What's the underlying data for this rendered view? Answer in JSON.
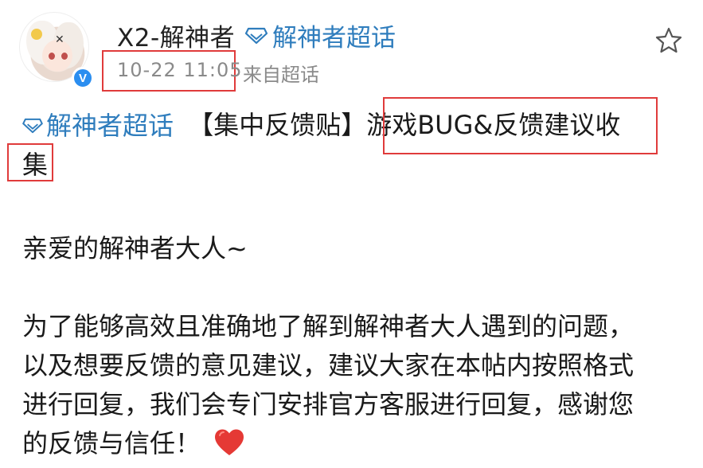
{
  "header": {
    "username": "X2-解神者",
    "topic_tag": "解神者超话",
    "timestamp": "10-22 11:05",
    "source": "来自超话",
    "verified_badge": "V"
  },
  "post": {
    "topic_tag": "解神者超话",
    "title_prefix": "【集中反馈贴】",
    "title_highlight": "游戏BUG&反馈建议收",
    "title_continuation": "集",
    "greeting": "亲爱的解神者大人~",
    "paragraph_lines": [
      "为了能够高效且准确地了解到解神者大人遇到的问题，",
      "以及想要反馈的意见建议，建议大家在本帖内按照格式",
      "进行回复，我们会专门安排官方客服进行回复，感谢您",
      "的反馈与信任！"
    ]
  },
  "icons": {
    "topic": "diamond-icon",
    "favorite": "star-icon",
    "heart": "heart-icon"
  },
  "colors": {
    "link": "#2f7dbd",
    "annotation": "#e03b3b",
    "meta_text": "#8a8a8a",
    "verified": "#2b8ef0",
    "heart": "#e53935"
  }
}
